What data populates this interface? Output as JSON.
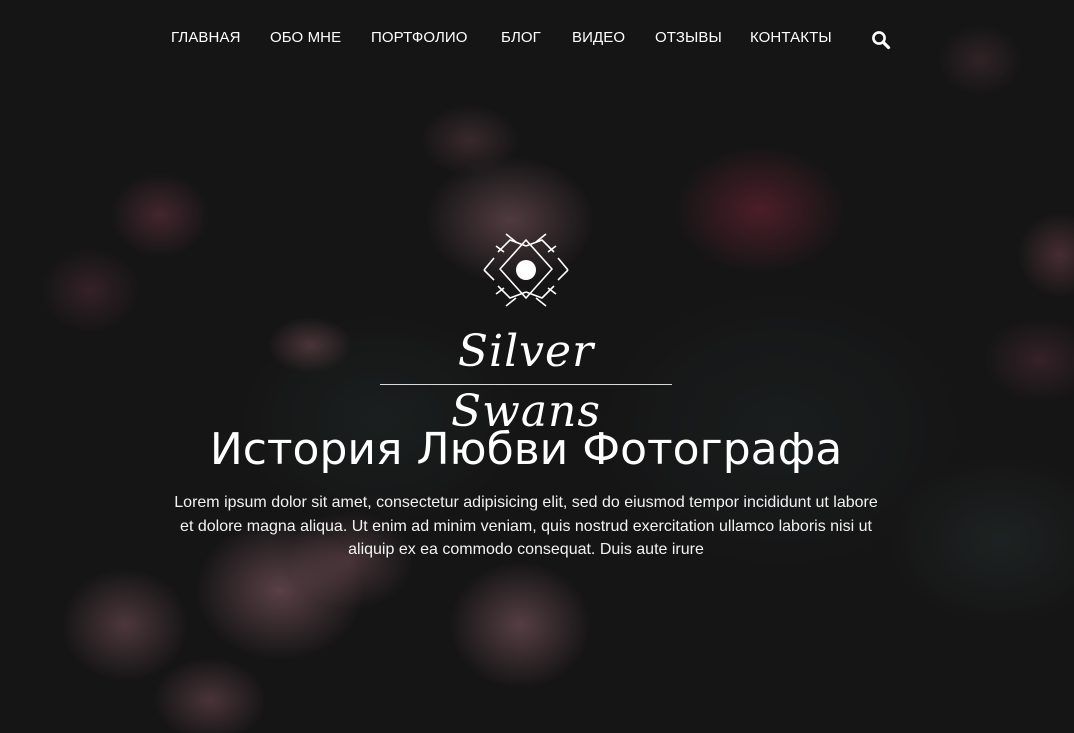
{
  "nav": {
    "items": [
      {
        "label": "ГЛАВНАЯ"
      },
      {
        "label": "ОБО МНЕ"
      },
      {
        "label": "ПОРТФОЛИО"
      },
      {
        "label": "БЛОГ"
      },
      {
        "label": "ВИДЕО"
      },
      {
        "label": "ОТЗЫВЫ"
      },
      {
        "label": "КОНТАКТЫ"
      }
    ],
    "search_icon": "search-icon"
  },
  "hero": {
    "logo_icon": "diamond-sun-logo",
    "brand_name": "Silver Swans",
    "headline": "История Любви Фотографа",
    "lead": "Lorem ipsum dolor sit amet, consectetur adipisicing elit, sed do eiusmod tempor incididunt ut labore et dolore magna aliqua. Ut enim ad minim veniam, quis nostrud exercitation ullamco laboris nisi ut aliquip ex ea commodo consequat. Duis aute irure"
  },
  "colors": {
    "background": "#161516",
    "text": "#ffffff"
  }
}
